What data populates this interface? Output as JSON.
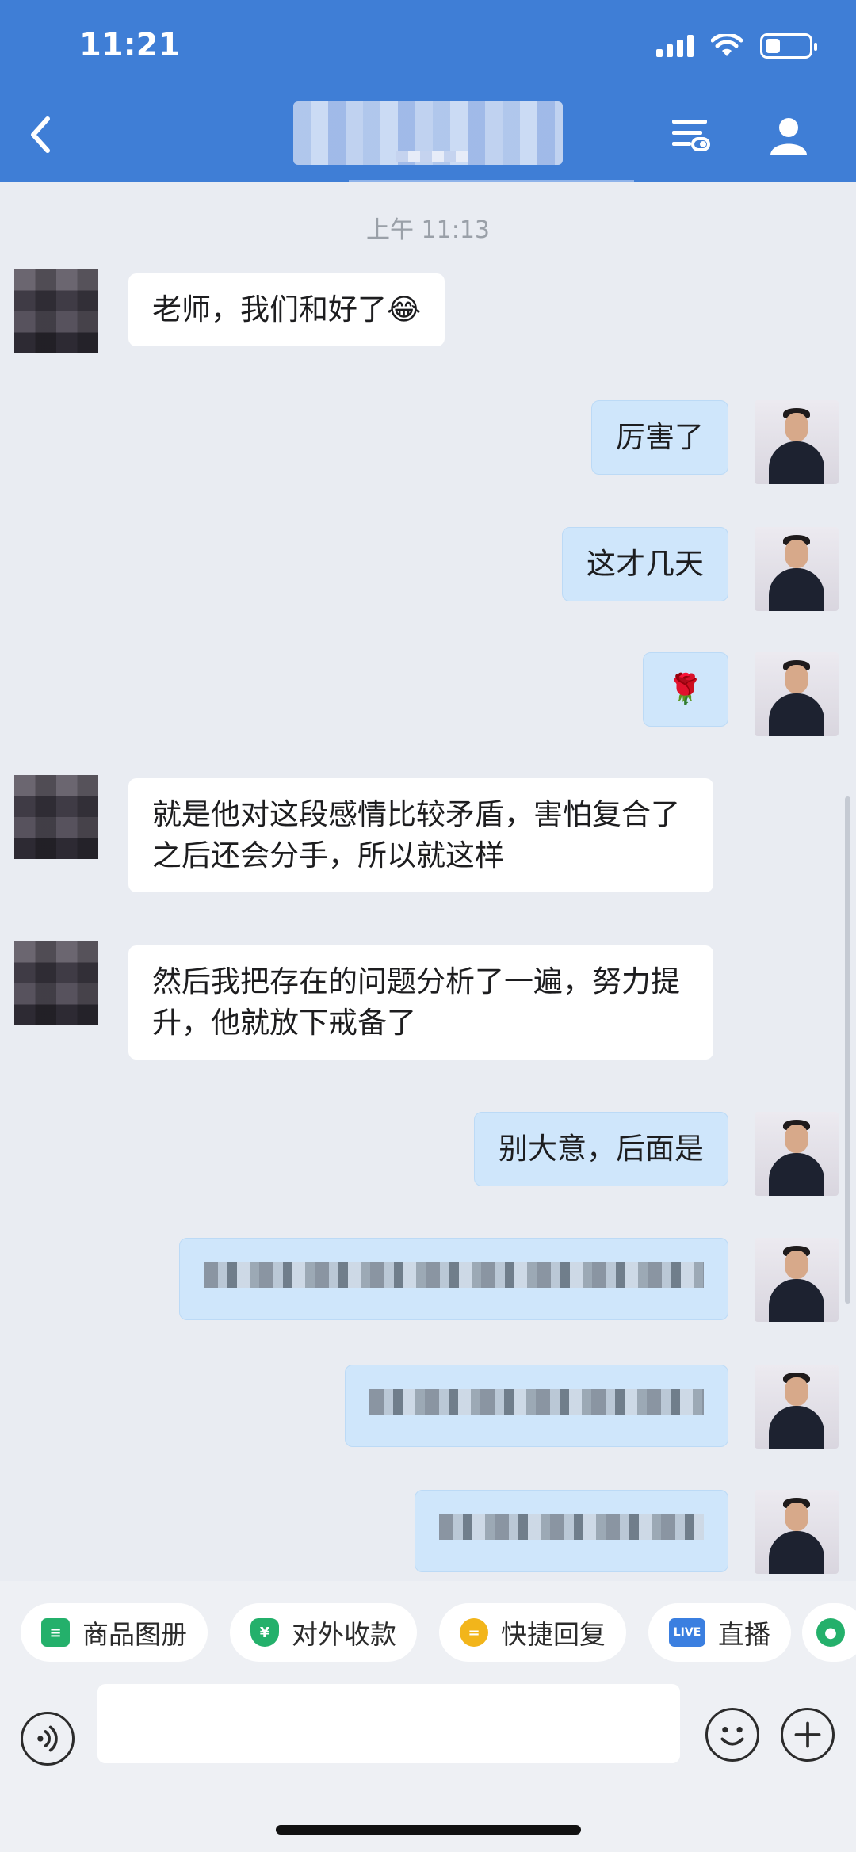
{
  "status_bar": {
    "time": "11:21"
  },
  "header": {
    "title": "",
    "accent_color": "#3f7ed6"
  },
  "chat": {
    "timestamp": "上午 11:13",
    "messages": [
      {
        "side": "in",
        "text": "老师，我们和好了"
      },
      {
        "side": "out",
        "text": "厉害了"
      },
      {
        "side": "out",
        "text": "这才几天"
      },
      {
        "side": "out",
        "text": "🌹"
      },
      {
        "side": "in",
        "text": "就是他对这段感情比较矛盾，害怕复合了之后还会分手，所以就这样"
      },
      {
        "side": "in",
        "text": "然后我把存在的问题分析了一遍，努力提升，他就放下戒备了"
      },
      {
        "side": "out",
        "text": "别大意，后面是"
      },
      {
        "side": "out",
        "text": ""
      },
      {
        "side": "out",
        "text": ""
      },
      {
        "side": "out",
        "text": ""
      }
    ]
  },
  "quick_actions": [
    {
      "label": "商品图册",
      "icon": "catalog-icon",
      "color": "#24b06b"
    },
    {
      "label": "对外收款",
      "icon": "yuan-shield-icon",
      "color": "#24b06b"
    },
    {
      "label": "快捷回复",
      "icon": "quick-reply-icon",
      "color": "#f2b51b"
    },
    {
      "label": "直播",
      "icon": "live-icon",
      "color": "#3b7fe0"
    }
  ],
  "input": {
    "placeholder": ""
  }
}
